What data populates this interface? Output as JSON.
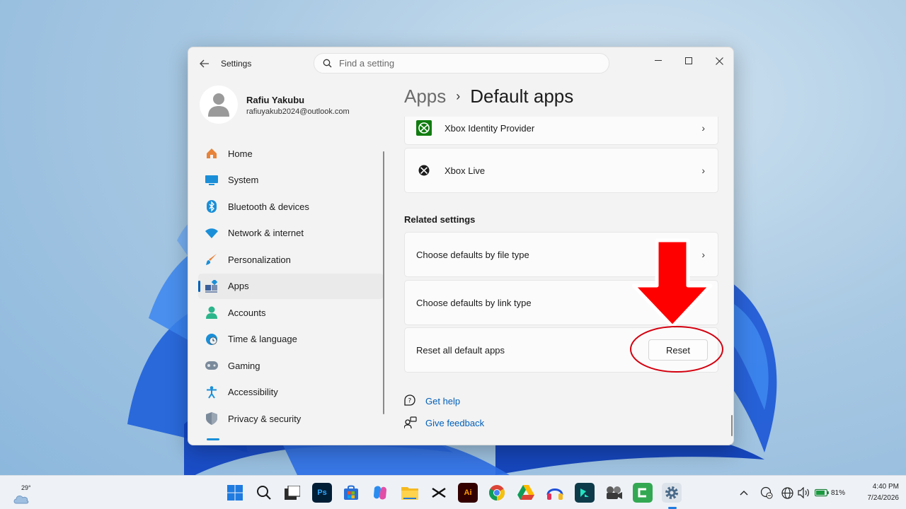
{
  "window": {
    "title": "Settings",
    "search_placeholder": "Find a setting"
  },
  "profile": {
    "name": "Rafiu Yakubu",
    "email": "rafiuyakub2024@outlook.com"
  },
  "sidebar": {
    "items": [
      {
        "label": "Home",
        "icon": "home-icon",
        "color": "#e8833a"
      },
      {
        "label": "System",
        "icon": "system-icon",
        "color": "#1a8fd8"
      },
      {
        "label": "Bluetooth & devices",
        "icon": "bluetooth-icon",
        "color": "#1a8fd8"
      },
      {
        "label": "Network & internet",
        "icon": "wifi-icon",
        "color": "#1a8fd8"
      },
      {
        "label": "Personalization",
        "icon": "brush-icon",
        "color": "#e8833a"
      },
      {
        "label": "Apps",
        "icon": "apps-icon",
        "color": "#3a5f9a",
        "active": true
      },
      {
        "label": "Accounts",
        "icon": "accounts-icon",
        "color": "#2bb58a"
      },
      {
        "label": "Time & language",
        "icon": "time-language-icon",
        "color": "#1a8fd8"
      },
      {
        "label": "Gaming",
        "icon": "gamepad-icon",
        "color": "#7b8a9b"
      },
      {
        "label": "Accessibility",
        "icon": "accessibility-icon",
        "color": "#1a8fd8"
      },
      {
        "label": "Privacy & security",
        "icon": "shield-icon",
        "color": "#7b8a9b"
      }
    ]
  },
  "breadcrumb": {
    "parent": "Apps",
    "separator": "›",
    "current": "Default apps"
  },
  "apps_list": [
    {
      "label": "Xbox Identity Provider",
      "icon": "xbox-identity-icon"
    },
    {
      "label": "Xbox Live",
      "icon": "xbox-live-icon"
    }
  ],
  "related_settings": {
    "title": "Related settings",
    "items": [
      {
        "label": "Choose defaults by file type"
      },
      {
        "label": "Choose defaults by link type"
      }
    ],
    "reset": {
      "label": "Reset all default apps",
      "button_label": "Reset"
    }
  },
  "help_links": [
    {
      "label": "Get help",
      "icon": "help-icon"
    },
    {
      "label": "Give feedback",
      "icon": "feedback-icon"
    }
  ],
  "annotation": {
    "arrow_color": "#ff0000",
    "circle_color": "#d4000f"
  },
  "taskbar": {
    "weather_temp": "29°",
    "battery_percent": "81%",
    "time": "4:40 PM",
    "date": "7/24/2026",
    "apps": [
      "windows-start-icon",
      "search-icon",
      "file-manager-icon",
      "photoshop-icon",
      "store-icon",
      "copilot-icon",
      "file-explorer-icon",
      "capcut-icon",
      "illustrator-icon",
      "chrome-icon",
      "drive-icon",
      "headphones-app-icon",
      "filmora-icon",
      "video-editor-icon",
      "camtasia-icon",
      "settings-icon"
    ],
    "tray": [
      "chevron-up-icon",
      "network-status-icon",
      "globe-icon",
      "volume-icon",
      "battery-icon"
    ]
  },
  "colors": {
    "accent": "#005fb8",
    "window_bg": "#f3f3f3",
    "card_bg": "#fbfbfb"
  }
}
